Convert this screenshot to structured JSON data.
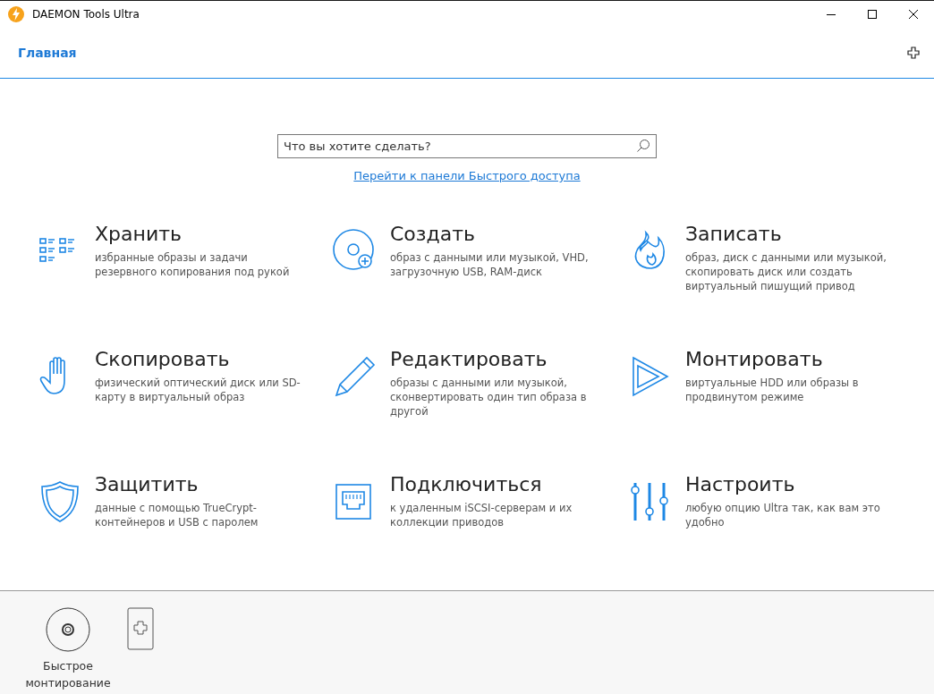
{
  "window": {
    "title": "DAEMON Tools Ultra"
  },
  "tabs": [
    {
      "label": "Главная",
      "selected": true
    }
  ],
  "search": {
    "placeholder": "Что вы хотите сделать?"
  },
  "quick_access_link": "Перейти к панели Быстрого доступа",
  "actions": [
    {
      "kind": "catalog",
      "title": "Хранить",
      "description": "избранные образы и задачи резервного копирования под рукой"
    },
    {
      "kind": "create",
      "title": "Создать",
      "description": "образ с данными или музыкой, VHD, загрузочную USB, RAM-диск"
    },
    {
      "kind": "burn",
      "title": "Записать",
      "description": "образ, диск с данными или музыкой, скопировать диск или создать виртуальный пишущий привод"
    },
    {
      "kind": "grab",
      "title": "Скопировать",
      "description": "физический оптический диск или SD-карту в виртуальный образ"
    },
    {
      "kind": "edit",
      "title": "Редактировать",
      "description": "образы с данными или музыкой, сконвертировать один тип образа в другой"
    },
    {
      "kind": "mount",
      "title": "Монтировать",
      "description": "виртуальные HDD или образы в продвинутом режиме"
    },
    {
      "kind": "protect",
      "title": "Защитить",
      "description": "данные с помощью TrueCrypt-контейнеров и USB с паролем"
    },
    {
      "kind": "connect",
      "title": "Подключиться",
      "description": "к удаленным iSCSI-серверам и их коллекции приводов"
    },
    {
      "kind": "settings",
      "title": "Настроить",
      "description": "любую опцию Ultra так, как вам это удобно"
    }
  ],
  "dock": [
    {
      "kind": "quick_mount",
      "label": "Быстрое монтирование"
    },
    {
      "kind": "add_device"
    }
  ]
}
